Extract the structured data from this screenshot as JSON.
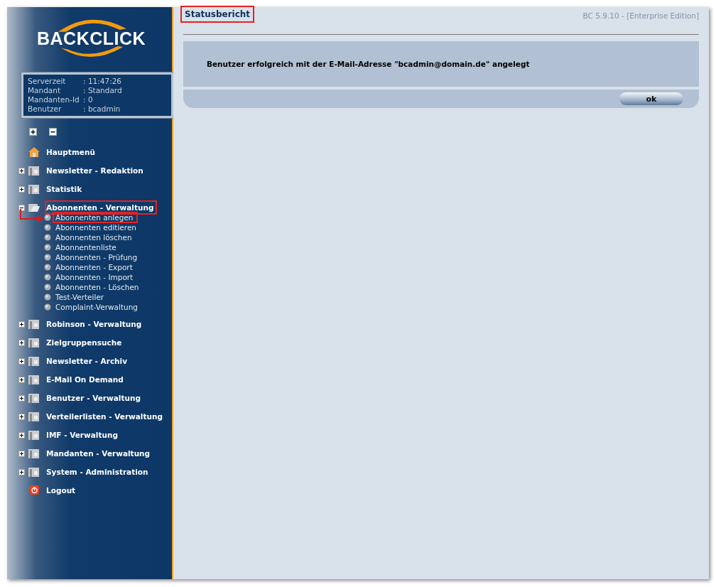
{
  "logo": {
    "text": "BACKCLICK"
  },
  "server_info": [
    {
      "label": "Serverzeit",
      "value": ": 11:47:26"
    },
    {
      "label": "Mandant",
      "value": ": Standard"
    },
    {
      "label": "Mandanten-Id",
      "value": ": 0"
    },
    {
      "label": "Benutzer",
      "value": ": bcadmin"
    }
  ],
  "tree_controls": [
    {
      "kind": "expand-all"
    },
    {
      "kind": "collapse-all"
    }
  ],
  "menu": [
    {
      "kind": "home",
      "label": "Hauptmenü",
      "highlighted": false
    },
    {
      "kind": "folder",
      "label": "Newsletter - Redaktion",
      "expanded": false,
      "highlighted": false
    },
    {
      "kind": "folder",
      "label": "Statistik",
      "expanded": false,
      "highlighted": false
    },
    {
      "kind": "folder",
      "label": "Abonnenten - Verwaltung",
      "expanded": true,
      "highlighted": true,
      "children": [
        {
          "label": "Abonnenten anlegen",
          "highlighted": true
        },
        {
          "label": "Abonnenten editieren",
          "highlighted": false
        },
        {
          "label": "Abonnenten löschen",
          "highlighted": false
        },
        {
          "label": "Abonnentenliste",
          "highlighted": false
        },
        {
          "label": "Abonnenten - Prüfung",
          "highlighted": false
        },
        {
          "label": "Abonnenten - Export",
          "highlighted": false
        },
        {
          "label": "Abonnenten - Import",
          "highlighted": false
        },
        {
          "label": "Abonnenten - Löschen",
          "highlighted": false
        },
        {
          "label": "Test-Verteiler",
          "highlighted": false
        },
        {
          "label": "Complaint-Verwaltung",
          "highlighted": false
        }
      ]
    },
    {
      "kind": "folder",
      "label": "Robinson - Verwaltung",
      "expanded": false,
      "highlighted": false
    },
    {
      "kind": "folder",
      "label": "Zielgruppensuche",
      "expanded": false,
      "highlighted": false
    },
    {
      "kind": "folder",
      "label": "Newsletter - Archiv",
      "expanded": false,
      "highlighted": false
    },
    {
      "kind": "folder",
      "label": "E-Mail On Demand",
      "expanded": false,
      "highlighted": false
    },
    {
      "kind": "folder",
      "label": "Benutzer - Verwaltung",
      "expanded": false,
      "highlighted": false
    },
    {
      "kind": "folder",
      "label": "Verteilerlisten - Verwaltung",
      "expanded": false,
      "highlighted": false
    },
    {
      "kind": "folder",
      "label": "IMF - Verwaltung",
      "expanded": false,
      "highlighted": false
    },
    {
      "kind": "folder",
      "label": "Mandanten - Verwaltung",
      "expanded": false,
      "highlighted": false
    },
    {
      "kind": "folder",
      "label": "System - Administration",
      "expanded": false,
      "highlighted": false
    },
    {
      "kind": "logout",
      "label": "Logout",
      "highlighted": false
    }
  ],
  "page": {
    "title": "Statusbericht",
    "title_highlighted": true,
    "version": "BC 5.9.10 - [Enterprise Edition]"
  },
  "status_message": "Benutzer erfolgreich mit der E-Mail-Adresse \"bcadmin@domain.de\" angelegt",
  "ok_button": "ok"
}
